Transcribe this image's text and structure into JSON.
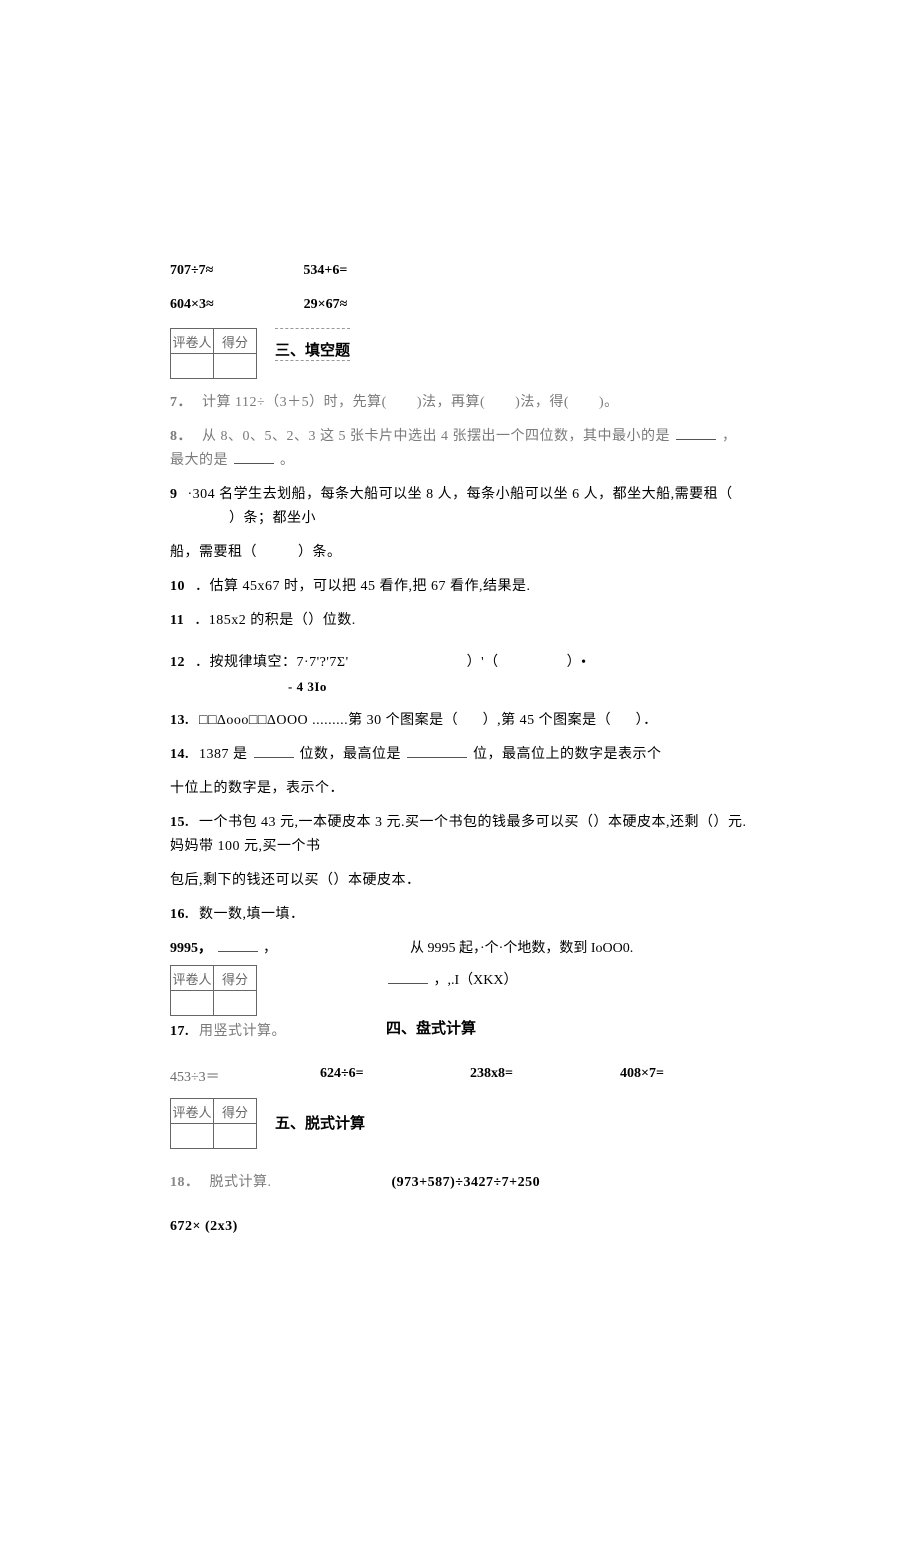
{
  "topRow1": {
    "a": "707÷7≈",
    "b": "534+6="
  },
  "topRow2": {
    "a": "604×3≈",
    "b": "29×67≈"
  },
  "score": {
    "h1": "评卷人",
    "h2": "得分"
  },
  "section3": {
    "title": "三、填空题"
  },
  "q7": {
    "num": "7．",
    "text_a": "计算 112÷（3＋5）时，先算(",
    "text_b": ")法，再算(",
    "text_c": ")法，得(",
    "text_d": ")。"
  },
  "q8": {
    "num": "8．",
    "text_a": "从 8、0、5、2、3 这 5 张卡片中选出 4 张摆出一个四位数，其中最小的是",
    "text_b": "，最大的是",
    "text_c": "。"
  },
  "q9": {
    "num": "9",
    "text_a": "·304 名学生去划船，每条大船可以坐 8 人，每条小船可以坐 6 人，都坐大船,需要租（",
    "text_b": "）条；都坐小",
    "text_c": "船，需要租（",
    "text_d": "）条。"
  },
  "q10": {
    "num": "10",
    "text": "．估算 45x67 时，可以把 45 看作,把 67 看作,结果是."
  },
  "q11": {
    "num": "11",
    "text": "．185x2 的积是（）位数."
  },
  "q12": {
    "num": "12",
    "text_a": "．按规律填空：7·7'?'7Σ'",
    "text_b": "）'（",
    "text_c": "）•",
    "sub": "-    4    3Io"
  },
  "q13": {
    "num": "13.",
    "text_a": "□□Δooo□□ΔOOO .........第 30 个图案是（",
    "text_b": "）,第 45 个图案是（",
    "text_c": "）．"
  },
  "q14": {
    "num": "14.",
    "text_a": "1387 是",
    "text_b": "位数，最高位是",
    "text_c": "位，最高位上的数字是表示个"
  },
  "q14b": "十位上的数字是，表示个．",
  "q15": {
    "num": "15.",
    "text_a": "一个书包 43 元,一本硬皮本 3 元.买一个书包的钱最多可以买（）本硬皮本,还剩（）元.妈妈带 100 元,买一个书",
    "text_b": "包后,剩下的钱还可以买（）本硬皮本．"
  },
  "q16": {
    "num": "16.",
    "text_a": "数一数,填一填．",
    "right_a": "从 9995 起，·个·个地数，数到 IoOO0.",
    "left_b": "9995，",
    "left_c": "，",
    "right_b": "，,.I（XKX）"
  },
  "section4": {
    "title": "四、盘式计算"
  },
  "q17": {
    "num": "17.",
    "text": "用竖式计算。"
  },
  "calcRow": {
    "a": "453÷3＝",
    "b": "624÷6=",
    "c": "238x8=",
    "d": "408×7="
  },
  "section5": {
    "title": "五、脱式计算"
  },
  "q18": {
    "num": "18．",
    "text": "脱式计算.",
    "right": "(973+587)÷3427÷7+250",
    "b": "672× (2x3)"
  }
}
